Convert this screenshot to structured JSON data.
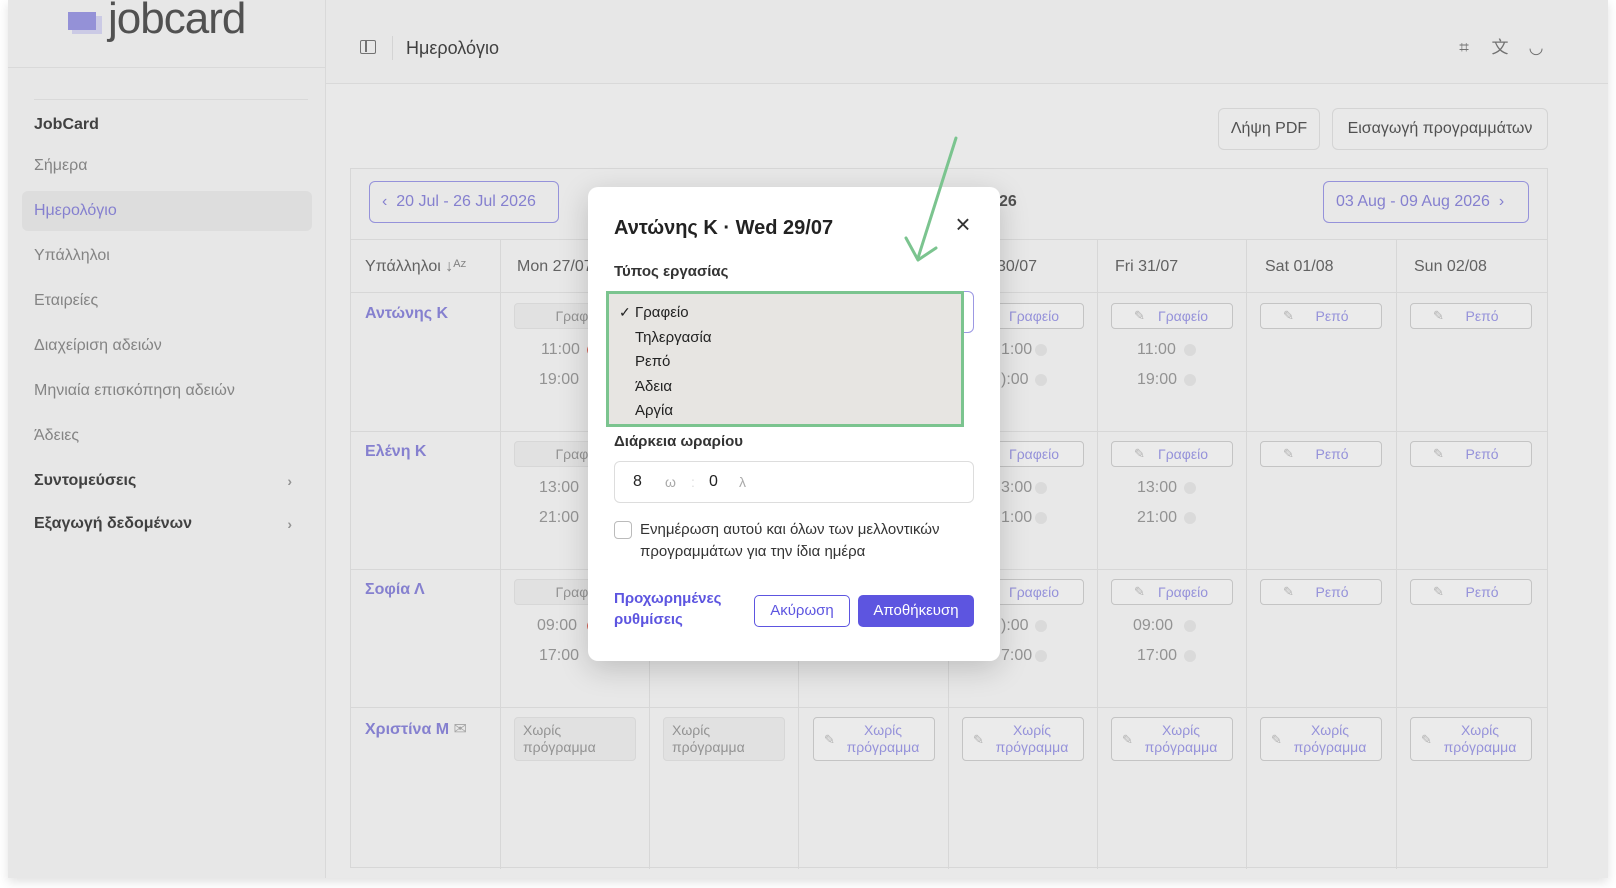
{
  "logo": {
    "text": "jobcard"
  },
  "sidebar": {
    "section": "JobCard",
    "items": [
      {
        "label": "Σήμερα"
      },
      {
        "label": "Ημερολόγιο"
      },
      {
        "label": "Υπάλληλοι"
      },
      {
        "label": "Εταιρείες"
      },
      {
        "label": "Διαχείριση αδειών"
      },
      {
        "label": "Μηνιαία επισκόπηση αδειών"
      },
      {
        "label": "Άδειες"
      },
      {
        "label": "Συντομεύσεις"
      },
      {
        "label": "Εξαγωγή δεδομένων"
      }
    ]
  },
  "header": {
    "title": "Ημερολόγιο"
  },
  "actions": {
    "pdf": "Λήψη PDF",
    "import": "Εισαγωγή προγραμμάτων"
  },
  "calendar": {
    "prev_week": "20 Jul - 26 Jul 2026",
    "current_week_fragment": "26",
    "next_week": "03 Aug - 09 Aug 2026",
    "employees_header": "Υπάλληλοι",
    "days": [
      "Mon 27/07",
      "30/07",
      "Fri 31/07",
      "Sat 01/08",
      "Sun 02/08"
    ],
    "employees": [
      {
        "name": "Αντώνης Κ",
        "mon_type": "Γραφε",
        "mon_start": "11:00",
        "mon_end": "19:00",
        "thu_type": "Γραφείο",
        "thu_start": "1:00",
        "thu_end": "):00",
        "fri_type": "Γραφείο",
        "fri_start": "11:00",
        "fri_end": "19:00",
        "sat": "Ρεπό",
        "sun": "Ρεπό"
      },
      {
        "name": "Ελένη Κ",
        "mon_type": "Γραφε",
        "mon_start": "13:00",
        "mon_end": "21:00",
        "thu_type": "Γραφείο",
        "thu_start": "3:00",
        "thu_end": "1:00",
        "fri_type": "Γραφείο",
        "fri_start": "13:00",
        "fri_end": "21:00",
        "sat": "Ρεπό",
        "sun": "Ρεπό"
      },
      {
        "name": "Σοφία Λ",
        "mon_type": "Γραφε",
        "mon_start": "09:00",
        "mon_end": "17:00",
        "thu_type": "Γραφείο",
        "thu_start": "):00",
        "thu_end": "7:00",
        "fri_type": "Γραφείο",
        "fri_start": "09:00",
        "fri_end": "17:00",
        "sat": "Ρεπό",
        "sun": "Ρεπό"
      },
      {
        "name": "Χριστίνα Μ",
        "no_schedule": "Χωρίς πρόγραμμα"
      }
    ]
  },
  "modal": {
    "title": "Αντώνης Κ · Wed 29/07",
    "work_type_label": "Τύπος εργασίας",
    "options": [
      "Γραφείο",
      "Τηλεργασία",
      "Ρεπό",
      "Άδεια",
      "Αργία"
    ],
    "selected_mark": "✓",
    "duration_label": "Διάρκεια ωραρίου",
    "hours": "8",
    "hours_unit": "ω",
    "minutes": "0",
    "minutes_unit": "λ",
    "checkbox_label": "Ενημέρωση αυτού και όλων των μελλοντικών προγραμμάτων για την ίδια ημέρα",
    "advanced": "Προχωρημένες ρυθμίσεις",
    "cancel": "Ακύρωση",
    "save": "Αποθήκευση"
  },
  "colors": {
    "accent": "#5d55e0",
    "link": "#8b86d8",
    "highlight": "#7bc48f",
    "dot_red": "#e06b5f"
  }
}
